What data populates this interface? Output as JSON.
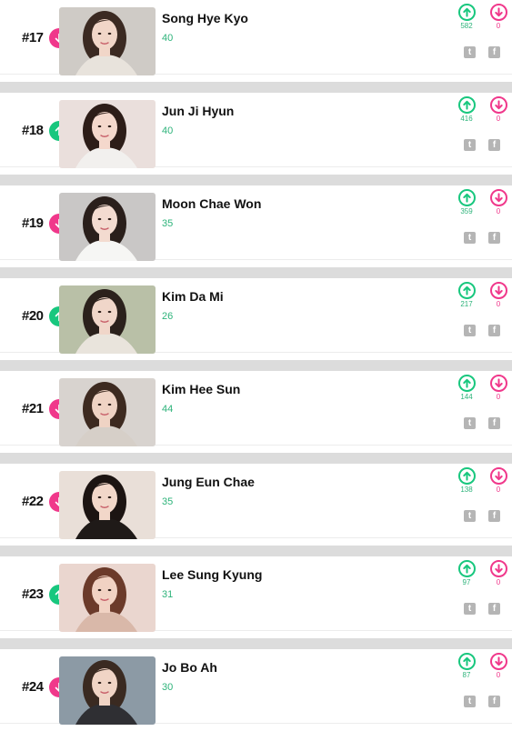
{
  "entries": [
    {
      "rank": "#17",
      "trend": "down",
      "name": "Song Hye Kyo",
      "score": "40",
      "up_votes": "582",
      "down_votes": "0",
      "photo": {
        "bg": "#cfcbc6",
        "hair": "#3b2a22",
        "skin": "#f1d6c8",
        "cloth": "#e8e3dc"
      }
    },
    {
      "rank": "#18",
      "trend": "up",
      "name": "Jun Ji Hyun",
      "score": "40",
      "up_votes": "416",
      "down_votes": "0",
      "photo": {
        "bg": "#eadfdc",
        "hair": "#2d1d18",
        "skin": "#f4d8cc",
        "cloth": "#f2f0ee"
      }
    },
    {
      "rank": "#19",
      "trend": "down",
      "name": "Moon Chae Won",
      "score": "35",
      "up_votes": "359",
      "down_votes": "0",
      "photo": {
        "bg": "#c9c7c6",
        "hair": "#2a1f1b",
        "skin": "#f3dbd0",
        "cloth": "#f6f6f4"
      }
    },
    {
      "rank": "#20",
      "trend": "up",
      "name": "Kim Da Mi",
      "score": "26",
      "up_votes": "217",
      "down_votes": "0",
      "photo": {
        "bg": "#b9c0a7",
        "hair": "#2b211c",
        "skin": "#f0d6c9",
        "cloth": "#e9e4dc"
      }
    },
    {
      "rank": "#21",
      "trend": "down",
      "name": "Kim Hee Sun",
      "score": "44",
      "up_votes": "144",
      "down_votes": "0",
      "photo": {
        "bg": "#d8d3cf",
        "hair": "#3d2a20",
        "skin": "#efd3c4",
        "cloth": "#d6cfc8"
      }
    },
    {
      "rank": "#22",
      "trend": "down",
      "name": "Jung Eun Chae",
      "score": "35",
      "up_votes": "138",
      "down_votes": "0",
      "photo": {
        "bg": "#e9dfd8",
        "hair": "#1c1412",
        "skin": "#f2d7c9",
        "cloth": "#1f1a18"
      }
    },
    {
      "rank": "#23",
      "trend": "up",
      "name": "Lee Sung Kyung",
      "score": "31",
      "up_votes": "97",
      "down_votes": "0",
      "photo": {
        "bg": "#ead6cf",
        "hair": "#6b3a2a",
        "skin": "#f1d2c3",
        "cloth": "#d9b8a9"
      }
    },
    {
      "rank": "#24",
      "trend": "down",
      "name": "Jo Bo Ah",
      "score": "30",
      "up_votes": "87",
      "down_votes": "0",
      "photo": {
        "bg": "#8c9aa5",
        "hair": "#3a2a21",
        "skin": "#f0d4c5",
        "cloth": "#2f2f33"
      }
    }
  ],
  "icons": {
    "trend_down": "arrow-down-icon",
    "trend_up": "arrow-up-icon",
    "vote_up": "upvote-circle-icon",
    "vote_down": "downvote-circle-icon",
    "twitter": "twitter-icon",
    "facebook": "facebook-icon"
  },
  "share": {
    "twitter_glyph": "t",
    "facebook_glyph": "f"
  },
  "colors": {
    "up": "#18c77e",
    "down": "#f0388b",
    "score": "#2db37a",
    "separator": "#dcdcdc"
  }
}
